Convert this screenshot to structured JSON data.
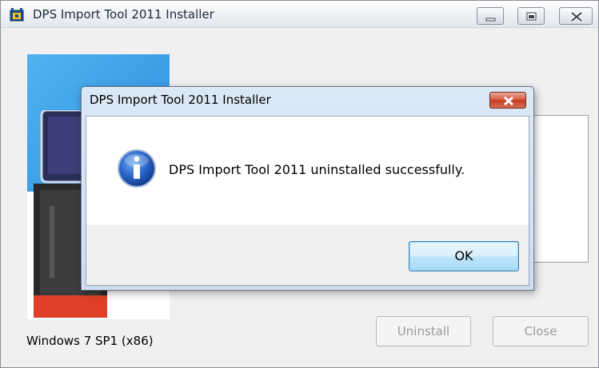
{
  "window": {
    "title": "DPS Import Tool 2011 Installer",
    "controls": {
      "minimize_icon": "minimize-icon",
      "maximize_icon": "maximize-icon",
      "close_icon": "close-icon"
    }
  },
  "main": {
    "os_label": "Windows 7 SP1 (x86)",
    "buttons": {
      "uninstall_label": "Uninstall",
      "close_label": "Close"
    },
    "banner": {
      "accent_color": "#3aa0e8"
    }
  },
  "dialog": {
    "title": "DPS Import Tool 2011 Installer",
    "message": "DPS Import Tool 2011 uninstalled successfully.",
    "icon": "info-icon",
    "ok_label": "OK",
    "close_icon": "close-icon",
    "close_color": "#c94a2f"
  }
}
